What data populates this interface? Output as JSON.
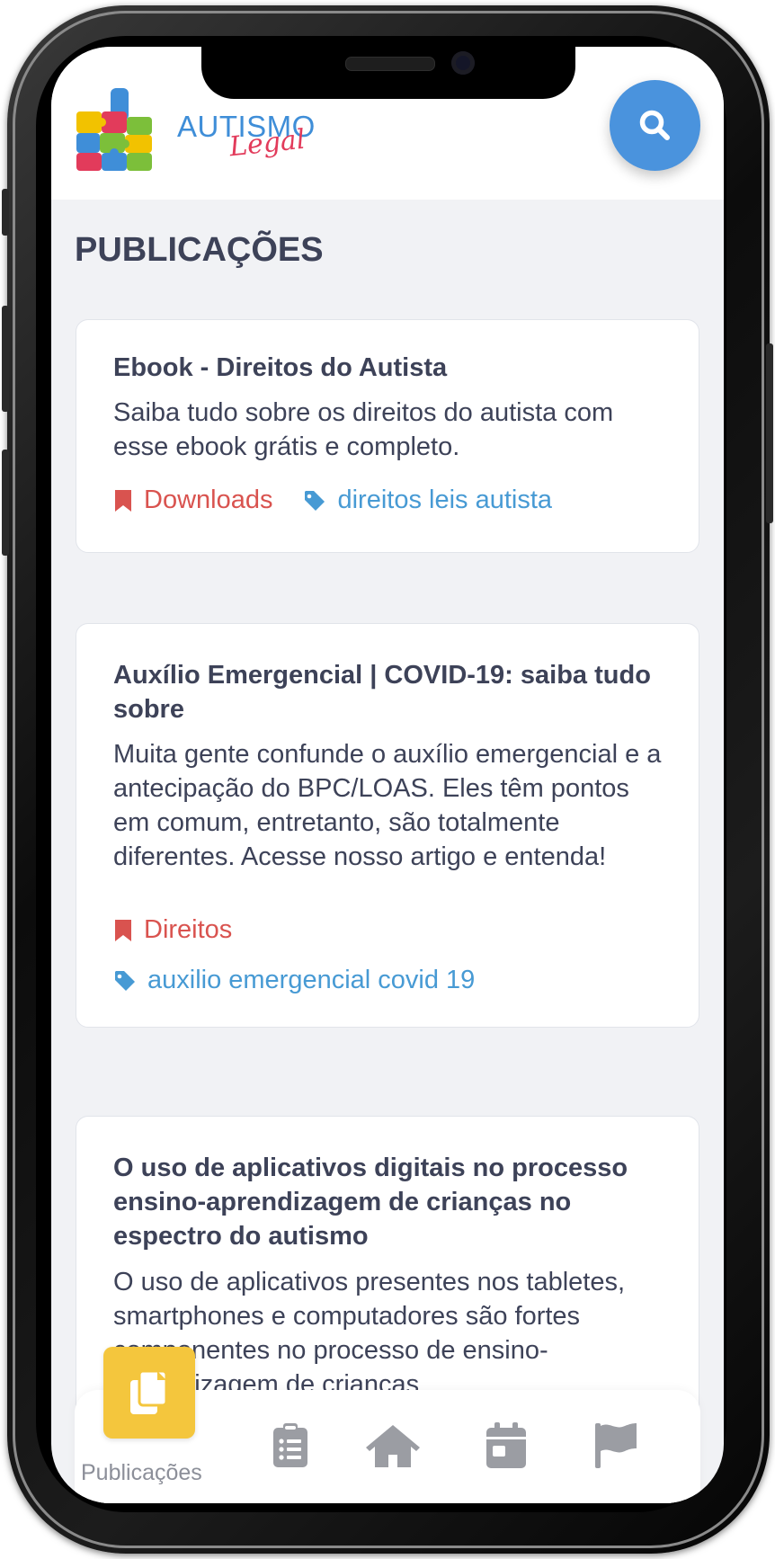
{
  "header": {
    "brand_main": "AUTISMO",
    "brand_script": "Legal",
    "search_icon": "search-icon"
  },
  "page": {
    "title": "PUBLICAÇÕES"
  },
  "posts": [
    {
      "title": "Ebook - Direitos do Autista",
      "excerpt": "Saiba tudo sobre os direitos do autista com esse ebook grátis e completo.",
      "category": "Downloads",
      "tags": "direitos leis autista"
    },
    {
      "title": "Auxílio Emergencial | COVID-19: saiba tudo sobre",
      "excerpt": "Muita gente confunde o auxílio emergencial e a antecipação do BPC/LOAS. Eles têm pontos em comum, entretanto, são totalmente diferentes. Acesse nosso artigo e entenda!",
      "category": "Direitos",
      "tags": "auxilio emergencial covid 19"
    },
    {
      "title": "O uso de aplicativos digitais no processo ensino-aprendizagem de crianças no espectro do autismo",
      "excerpt": "O uso de aplicativos presentes nos tabletes, smartphones e computadores são fortes componentes no processo de ensino-aprendizagem de crianças"
    }
  ],
  "bottom_nav": {
    "active_label": "Publicações",
    "items": [
      "copy-icon",
      "clipboard-list-icon",
      "home-icon",
      "calendar-icon",
      "flag-icon"
    ]
  },
  "colors": {
    "accent_blue": "#4a93dd",
    "category_red": "#d9534f",
    "tag_blue": "#479ad4",
    "active_yellow": "#f4c63d",
    "text_dark": "#3d4258"
  }
}
